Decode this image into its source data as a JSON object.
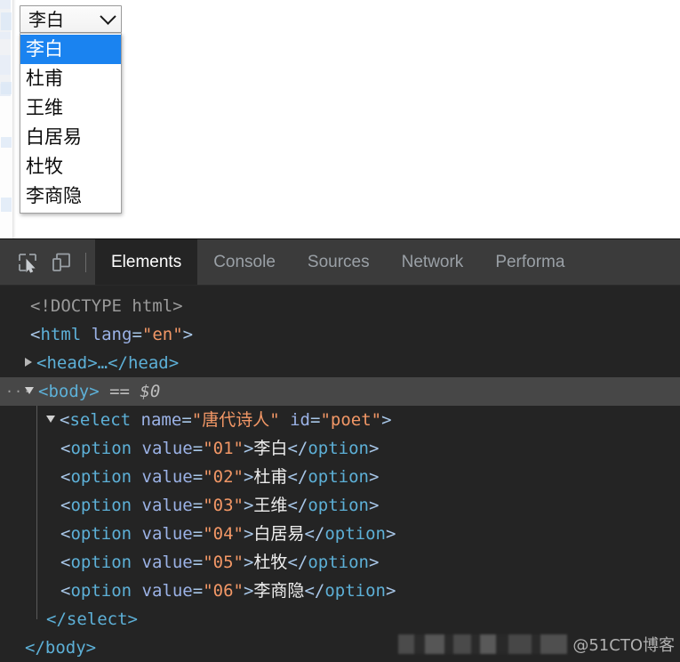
{
  "page": {
    "select": {
      "name": "select-control",
      "selected_label": "李白",
      "chevron_icon": "chevron-down-icon",
      "options": [
        {
          "label": "李白",
          "value": "01",
          "selected": true
        },
        {
          "label": "杜甫",
          "value": "02",
          "selected": false
        },
        {
          "label": "王维",
          "value": "03",
          "selected": false
        },
        {
          "label": "白居易",
          "value": "04",
          "selected": false
        },
        {
          "label": "杜牧",
          "value": "05",
          "selected": false
        },
        {
          "label": "李商隐",
          "value": "06",
          "selected": false
        }
      ]
    }
  },
  "devtools": {
    "toolbar": {
      "inspect_icon": "inspect-element-icon",
      "device_icon": "device-toolbar-icon"
    },
    "tabs": [
      {
        "label": "Elements",
        "active": true
      },
      {
        "label": "Console",
        "active": false
      },
      {
        "label": "Sources",
        "active": false
      },
      {
        "label": "Network",
        "active": false
      },
      {
        "label": "Performa",
        "active": false
      }
    ],
    "dom": {
      "doctype": "<!DOCTYPE html>",
      "doctype_keyword": "DOCTYPE",
      "html_open_tag": "html",
      "html_attr_name": "lang",
      "html_attr_value": "\"en\"",
      "head_collapsed": "<head>…</head>",
      "body_tag": "<body>",
      "body_marker": "···",
      "body_ref": "== $0",
      "select_tag": "select",
      "select_attr1_name": "name",
      "select_attr1_value": "\"唐代诗人\"",
      "select_attr2_name": "id",
      "select_attr2_value": "\"poet\"",
      "option_tag": "option",
      "option_attr_name": "value",
      "options": [
        {
          "value": "\"01\"",
          "text": "李白"
        },
        {
          "value": "\"02\"",
          "text": "杜甫"
        },
        {
          "value": "\"03\"",
          "text": "王维"
        },
        {
          "value": "\"04\"",
          "text": "白居易"
        },
        {
          "value": "\"05\"",
          "text": "杜牧"
        },
        {
          "value": "\"06\"",
          "text": "李商隐"
        }
      ],
      "select_close": "</select>",
      "body_close": "</body>"
    },
    "watermark": "@51CTO博客"
  },
  "colors": {
    "option_highlight": "#1a83f0",
    "devtools_bg": "#242424",
    "toolbar_bg": "#3b3b3b",
    "tag_color": "#5db0d7",
    "attr_value_color": "#f29766"
  }
}
